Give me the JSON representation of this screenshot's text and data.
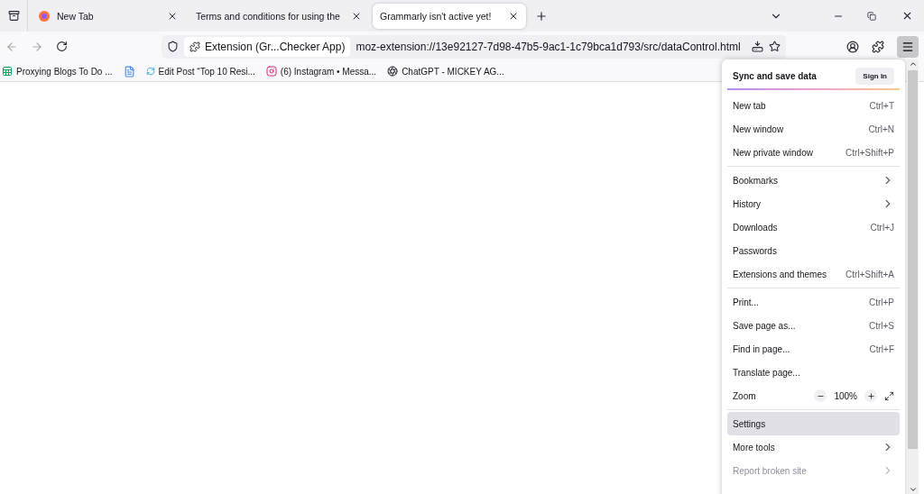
{
  "tabs": [
    {
      "title": "New Tab",
      "selected": false
    },
    {
      "title": "Terms and conditions for using the",
      "selected": false
    },
    {
      "title": "Grammarly isn't active yet!",
      "selected": true
    }
  ],
  "toolbar": {
    "identity": "Extension (Gr...Checker App)",
    "url": "moz-extension://13e92127-7d98-47b5-9ac1-1c79bca1d793/src/dataControl.html"
  },
  "bookmarks": [
    {
      "kind": "link",
      "label": "Proxying Blogs To Do ..."
    },
    {
      "kind": "icon"
    },
    {
      "kind": "link",
      "label": "Edit Post “Top 10 Resi..."
    },
    {
      "kind": "link",
      "label": "(6) Instagram • Messa..."
    },
    {
      "kind": "link",
      "label": "ChatGPT - MICKEY AG..."
    }
  ],
  "menu": {
    "header": "Sync and save data",
    "sign_in": "Sign In",
    "groups": [
      [
        {
          "kind": "shortcut",
          "label": "New tab",
          "shortcut": "Ctrl+T"
        },
        {
          "kind": "shortcut",
          "label": "New window",
          "shortcut": "Ctrl+N"
        },
        {
          "kind": "shortcut",
          "label": "New private window",
          "shortcut": "Ctrl+Shift+P"
        }
      ],
      [
        {
          "kind": "submenu",
          "label": "Bookmarks",
          "disabled": false
        },
        {
          "kind": "submenu",
          "label": "History",
          "disabled": false
        },
        {
          "kind": "shortcut",
          "label": "Downloads",
          "shortcut": "Ctrl+J"
        },
        {
          "kind": "plain",
          "label": "Passwords"
        },
        {
          "kind": "shortcut",
          "label": "Extensions and themes",
          "shortcut": "Ctrl+Shift+A"
        }
      ],
      [
        {
          "kind": "shortcut",
          "label": "Print...",
          "shortcut": "Ctrl+P"
        },
        {
          "kind": "shortcut",
          "label": "Save page as...",
          "shortcut": "Ctrl+S"
        },
        {
          "kind": "shortcut",
          "label": "Find in page...",
          "shortcut": "Ctrl+F"
        },
        {
          "kind": "plain",
          "label": "Translate page..."
        },
        {
          "kind": "zoom",
          "label": "Zoom",
          "value": "100%"
        }
      ],
      [
        {
          "kind": "plain",
          "label": "Settings",
          "selected": true
        },
        {
          "kind": "submenu",
          "label": "More tools",
          "disabled": false
        },
        {
          "kind": "submenu",
          "label": "Report broken site",
          "disabled": true
        }
      ]
    ]
  }
}
